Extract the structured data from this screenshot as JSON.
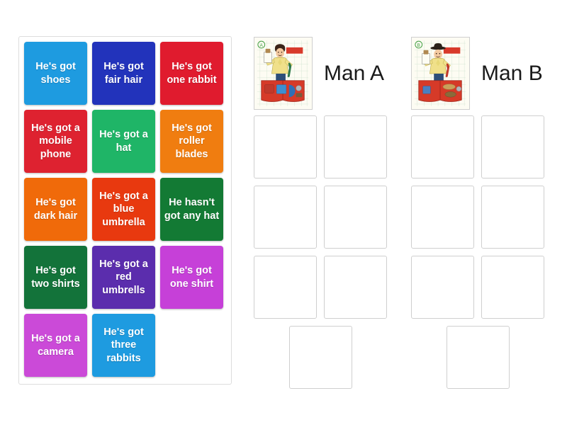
{
  "activity": {
    "type": "group-sort-drag-and-drop",
    "tile_text_color": "#ffffff"
  },
  "tiles": [
    {
      "label": "He's got shoes",
      "color": "#1E9BE0"
    },
    {
      "label": "He's got fair hair",
      "color": "#2233BB"
    },
    {
      "label": "He's got one rabbit",
      "color": "#E01B2E"
    },
    {
      "label": "He's got a mobile phone",
      "color": "#DE2230"
    },
    {
      "label": "He's got a hat",
      "color": "#1FB567"
    },
    {
      "label": "He's got roller blades",
      "color": "#F07D10"
    },
    {
      "label": "He's got dark hair",
      "color": "#F06A0A"
    },
    {
      "label": "He's got a blue umbrella",
      "color": "#E8390F"
    },
    {
      "label": "He hasn't got any hat",
      "color": "#137A34"
    },
    {
      "label": "He's got two shirts",
      "color": "#13733A"
    },
    {
      "label": "He's got a red umbrells",
      "color": "#5B2DAD"
    },
    {
      "label": "He's got one shirt",
      "color": "#C640D8"
    },
    {
      "label": "He's got a camera",
      "color": "#CB4AD8"
    },
    {
      "label": "He's got three rabbits",
      "color": "#1E9BE0"
    }
  ],
  "columns": [
    {
      "title": "Man A",
      "thumbnail": {
        "icon": "man-a-picture",
        "badge": "A",
        "alt": "Illustration of a man with dark hair holding an umbrella beside red shorts"
      },
      "dropzone_count": 7,
      "dropzones": [
        "",
        "",
        "",
        "",
        "",
        "",
        ""
      ]
    },
    {
      "title": "Man B",
      "thumbnail": {
        "icon": "man-b-picture",
        "badge": "B",
        "alt": "Illustration of a man wearing a hat holding an umbrella beside red shorts"
      },
      "dropzone_count": 7,
      "dropzones": [
        "",
        "",
        "",
        "",
        "",
        "",
        ""
      ]
    }
  ]
}
